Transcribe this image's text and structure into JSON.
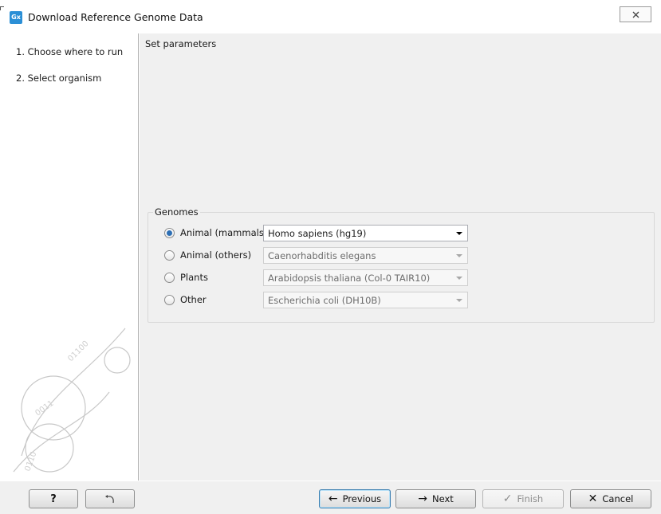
{
  "window": {
    "app_icon": "Gx",
    "title": "Download Reference Genome Data",
    "close_icon": "close-icon"
  },
  "steps": [
    {
      "label": "1.  Choose where to run"
    },
    {
      "label": "2.  Select organism"
    }
  ],
  "panel": {
    "title": "Set parameters",
    "group_label": "Genomes"
  },
  "options": [
    {
      "label": "Animal (mammals)",
      "selected": true,
      "value": "Homo sapiens (hg19)",
      "enabled": true
    },
    {
      "label": "Animal (others)",
      "selected": false,
      "value": "Caenorhabditis elegans",
      "enabled": false
    },
    {
      "label": "Plants",
      "selected": false,
      "value": "Arabidopsis thaliana (Col-0 TAIR10)",
      "enabled": false
    },
    {
      "label": "Other",
      "selected": false,
      "value": "Escherichia coli (DH10B)",
      "enabled": false
    }
  ],
  "buttons": {
    "help": "?",
    "previous": "Previous",
    "next": "Next",
    "finish": "Finish",
    "cancel": "Cancel"
  },
  "colors": {
    "accent": "#2d6fb4",
    "panel_bg": "#f0f0f0",
    "app_icon_bg": "#2b8fd6"
  }
}
